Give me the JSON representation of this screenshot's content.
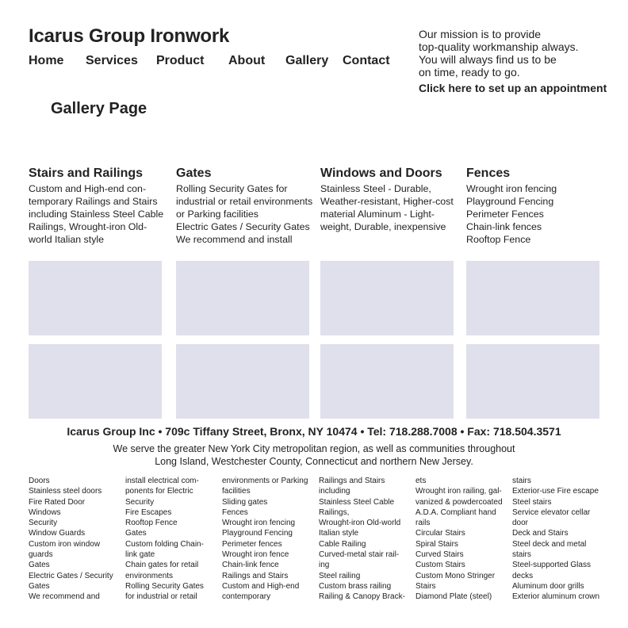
{
  "header": {
    "site_title": "Icarus Group Ironwork",
    "nav": [
      "Home",
      "Services",
      "Product",
      "About",
      "Gallery",
      "Contact"
    ],
    "mission_lines": [
      "Our mission is to provide",
      "top-quality workmanship always.",
      "You will always find us to be",
      "on time, ready to go."
    ],
    "appointment_link": "Click here to set up an appointment"
  },
  "main": {
    "page_heading": "Gallery Page",
    "categories": [
      {
        "title": "Stairs and Railings",
        "desc_lines": [
          "Custom and High-end con-",
          "temporary Railings and Stairs",
          "including Stainless Steel Cable",
          "Railings, Wrought-iron Old-",
          "world Italian style"
        ]
      },
      {
        "title": "Gates",
        "desc_lines": [
          "Rolling Security Gates for",
          "industrial or retail environments",
          "or Parking facilities",
          "Electric Gates / Security Gates",
          "We recommend and install"
        ]
      },
      {
        "title": "Windows and Doors",
        "desc_lines": [
          "Stainless Steel - Durable,",
          "Weather-resistant, Higher-cost",
          "material Aluminum - Light-",
          "weight, Durable, inexpensive"
        ]
      },
      {
        "title": "Fences",
        "desc_lines": [
          "Wrought iron fencing",
          "Playground Fencing",
          "Perimeter Fences",
          "Chain-link fences",
          "Rooftop Fence"
        ]
      }
    ],
    "tile_color": "#e0e0ec"
  },
  "footer": {
    "address": "Icarus Group Inc • 709c Tiffany Street, Bronx, NY 10474 • Tel:  718.288.7008 • Fax: 718.504.3571",
    "coverage_lines": [
      "We serve the greater New York City metropolitan region, as well as communities throughout",
      "Long Island, Westchester County, Connecticut and northern New Jersey."
    ],
    "link_columns": [
      [
        "Doors",
        "Stainless steel doors",
        "Fire Rated Door",
        "Windows",
        "Security",
        "Window Guards",
        "Custom iron window",
        "guards",
        "Gates",
        "Electric Gates / Security",
        "Gates",
        "We recommend and"
      ],
      [
        "install electrical com-",
        "ponents for Electric",
        "Security",
        "Fire Escapes",
        "Rooftop Fence",
        "Gates",
        "Custom folding Chain-",
        "link gate",
        "Chain gates for retail",
        "environments",
        "Rolling Security Gates",
        "for industrial or retail"
      ],
      [
        "environments or Parking",
        "facilities",
        "Sliding gates",
        "Fences",
        "Wrought iron fencing",
        "Playground Fencing",
        "Perimeter fences",
        "Wrought iron fence",
        "Chain-link fence",
        "Railings and Stairs",
        "Custom and High-end",
        "contemporary"
      ],
      [
        "Railings and Stairs",
        "including",
        "Stainless Steel Cable",
        "Railings,",
        "Wrought-iron Old-world",
        "Italian style",
        "Cable Railing",
        "Curved-metal stair rail-",
        "ing",
        "Steel railing",
        "Custom brass railing",
        "Railing & Canopy Brack-"
      ],
      [
        "ets",
        "Wrought iron railing, gal-",
        "vanized & powdercoated",
        "A.D.A. Compliant hand",
        "rails",
        "Circular Stairs",
        "Spiral Stairs",
        "Curved Stairs",
        "Custom Stairs",
        "Custom Mono Stringer",
        "Stairs",
        "Diamond Plate (steel)"
      ],
      [
        "stairs",
        "Exterior-use Fire escape",
        "Steel stairs",
        "Service elevator cellar",
        "door",
        "Deck and Stairs",
        "Steel deck and metal",
        "stairs",
        "Steel-supported Glass",
        "decks",
        "Aluminum door grills",
        "Exterior aluminum crown"
      ]
    ]
  }
}
